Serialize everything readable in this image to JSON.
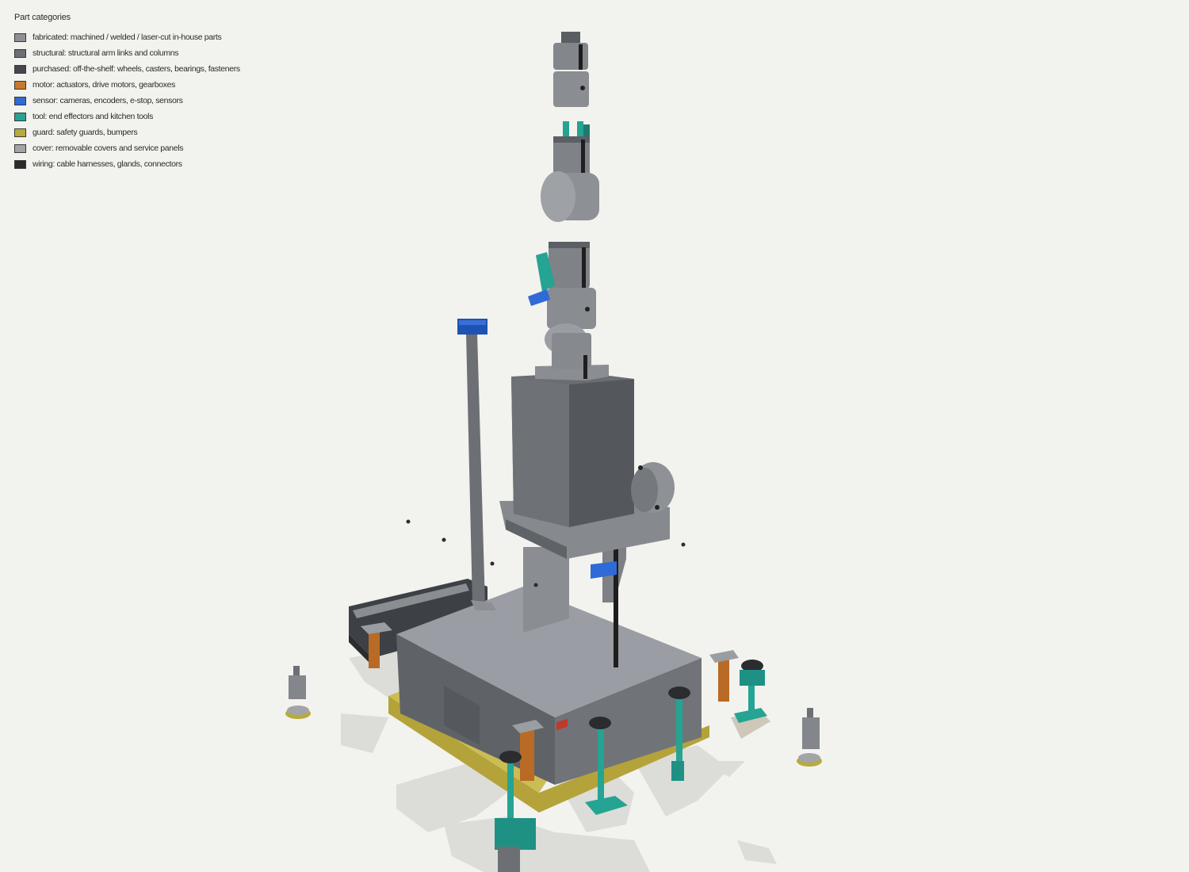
{
  "legend": {
    "title": "Part categories",
    "items": [
      {
        "key": "fabricated",
        "label": "fabricated: machined / welded / laser-cut in-house parts",
        "color": "#8e9094"
      },
      {
        "key": "structural",
        "label": "structural: structural arm links and columns",
        "color": "#6b6e73"
      },
      {
        "key": "purchased",
        "label": "purchased: off-the-shelf: wheels, casters, bearings, fasteners",
        "color": "#44474c"
      },
      {
        "key": "motor",
        "label": "motor: actuators, drive motors, gearboxes",
        "color": "#c8782a"
      },
      {
        "key": "sensor",
        "label": "sensor: cameras, encoders, e-stop, sensors",
        "color": "#2f6ad6"
      },
      {
        "key": "tool",
        "label": "tool: end effectors and kitchen tools",
        "color": "#25a393"
      },
      {
        "key": "guard",
        "label": "guard: safety guards, bumpers",
        "color": "#b8aa3c"
      },
      {
        "key": "cover",
        "label": "cover: removable covers and service panels",
        "color": "#a2a4a8"
      },
      {
        "key": "wiring",
        "label": "wiring: cable harnesses, glands, connectors",
        "color": "#2b2b2b"
      }
    ]
  }
}
